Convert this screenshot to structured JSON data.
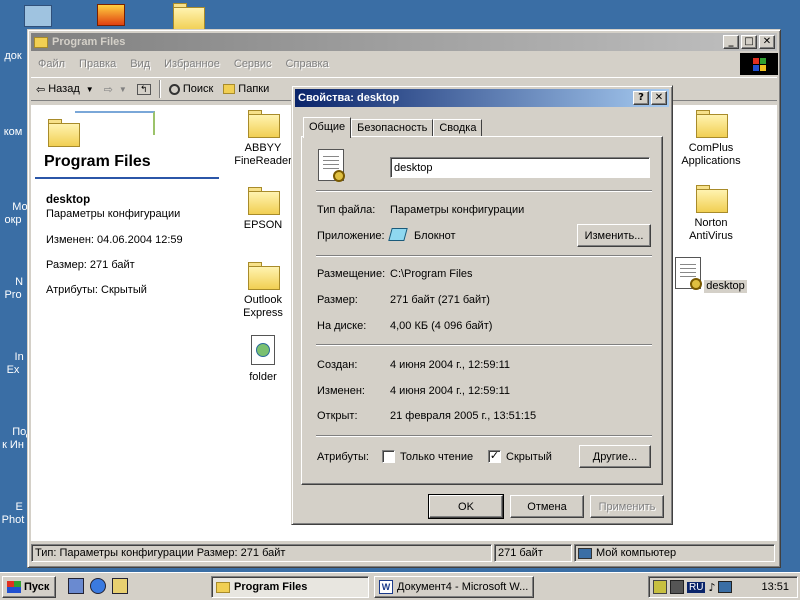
{
  "desktop": {
    "icons": [
      {
        "label": "док"
      },
      {
        "label": "ком"
      },
      {
        "label": "Мое\nокр"
      },
      {
        "label": "N\nPro"
      },
      {
        "label": "In\nEx"
      },
      {
        "label": "Подк\nк Ин"
      },
      {
        "label": "E\nPhot"
      }
    ]
  },
  "window": {
    "title": "Program Files",
    "menu": [
      "Файл",
      "Правка",
      "Вид",
      "Избранное",
      "Сервис",
      "Справка"
    ],
    "toolbar": {
      "back": "Назад",
      "search": "Поиск",
      "folders": "Папки"
    },
    "webview": {
      "heading": "Program Files",
      "selected_name": "desktop",
      "selected_type": "Параметры конфигурации",
      "modified": "Изменен: 04.06.2004 12:59",
      "size": "Размер: 271 байт",
      "attributes": "Атрибуты: Скрытый"
    },
    "items": [
      {
        "label": "ABBYY\nFineReader",
        "kind": "folder"
      },
      {
        "label": "EPSON",
        "kind": "folder"
      },
      {
        "label": "Outlook\nExpress",
        "kind": "folder"
      },
      {
        "label": "folder",
        "kind": "htt"
      },
      {
        "label": "ComPlus\nApplications",
        "kind": "folder"
      },
      {
        "label": "Norton\nAntiVirus",
        "kind": "folder"
      },
      {
        "label": "desktop",
        "kind": "ini"
      }
    ],
    "status": {
      "main": "Тип: Параметры конфигурации Размер: 271 байт",
      "size": "271 байт",
      "zone": "Мой компьютер"
    }
  },
  "dialog": {
    "title": "Свойства: desktop",
    "tabs": [
      "Общие",
      "Безопасность",
      "Сводка"
    ],
    "name_value": "desktop",
    "rows": {
      "type_label": "Тип файла:",
      "type_value": "Параметры конфигурации",
      "app_label": "Приложение:",
      "app_value": "Блокнот",
      "change_btn": "Изменить...",
      "location_label": "Размещение:",
      "location_value": "C:\\Program Files",
      "size_label": "Размер:",
      "size_value": "271 байт (271 байт)",
      "disk_label": "На диске:",
      "disk_value": "4,00 КБ (4 096 байт)",
      "created_label": "Создан:",
      "created_value": "4 июня 2004 г., 12:59:11",
      "modified_label": "Изменен:",
      "modified_value": "4 июня 2004 г., 12:59:11",
      "opened_label": "Открыт:",
      "opened_value": "21 февраля 2005 г., 13:51:15",
      "attr_label": "Атрибуты:",
      "readonly_label": "Только чтение",
      "hidden_label": "Скрытый",
      "other_btn": "Другие..."
    },
    "checkboxes": {
      "readonly": false,
      "hidden": true
    },
    "buttons": {
      "ok": "OK",
      "cancel": "Отмена",
      "apply": "Применить"
    }
  },
  "taskbar": {
    "start": "Пуск",
    "tasks": [
      "Program Files",
      "Документ4 - Microsoft W..."
    ],
    "lang": "RU",
    "clock": "13:51"
  }
}
